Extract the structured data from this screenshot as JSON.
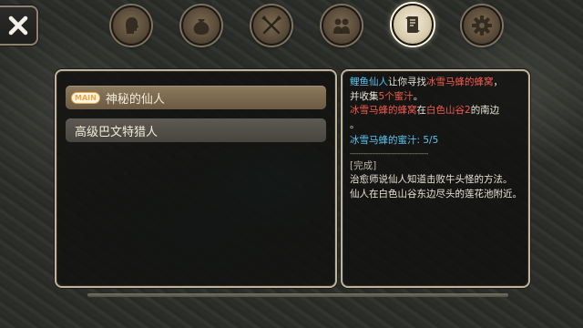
{
  "close_button": {
    "icon": "close-icon"
  },
  "tabs": [
    {
      "name": "character",
      "icon": "head-icon",
      "active": false
    },
    {
      "name": "bag",
      "icon": "bag-icon",
      "active": false
    },
    {
      "name": "skills",
      "icon": "swords-icon",
      "active": false
    },
    {
      "name": "community",
      "icon": "people-icon",
      "active": false
    },
    {
      "name": "quest",
      "icon": "scroll-icon",
      "active": true
    },
    {
      "name": "settings",
      "icon": "gear-icon",
      "active": false
    }
  ],
  "quest_list": [
    {
      "badge": "MAIN",
      "title": "神秘的仙人",
      "selected": true
    },
    {
      "badge": "",
      "title": "高级巴文特猎人",
      "selected": false
    }
  ],
  "quest_detail": {
    "line1_npc": "鲤鱼仙人",
    "line1_text": "让你寻找",
    "line1_item": "冰雪马蜂的蜂窝",
    "line1_end": "，",
    "line2_text": "并收集",
    "line2_item": "5个蜜汁",
    "line2_end": "。",
    "line3_item": "冰雪马蜂的蜂窝",
    "line3_text": "在",
    "line3_place": "白色山谷2",
    "line3_end": "的南边",
    "line4": "。",
    "progress_label": "冰雪马蜂的蜜汁: 5/5",
    "divider": "------------------------------------",
    "status": "[完成]",
    "text1": "治愈师说仙人知道击败牛头怪的方法。",
    "text2": "仙人在白色山谷东边尽头的莲花池附近。"
  }
}
